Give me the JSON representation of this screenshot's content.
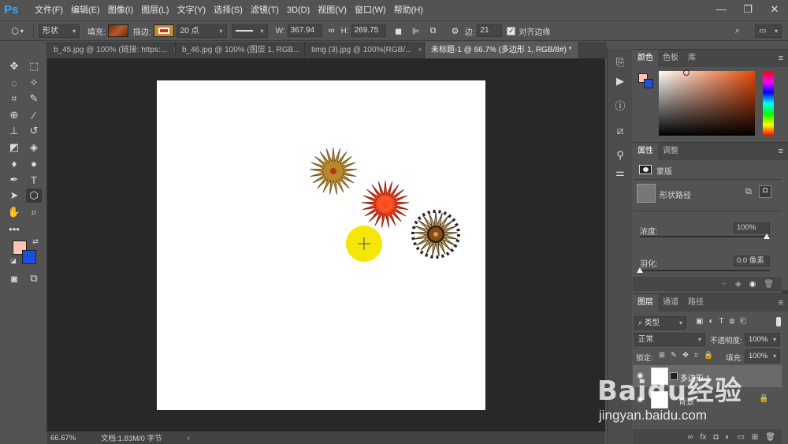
{
  "app": {
    "logo": "Ps"
  },
  "menu": [
    "文件(F)",
    "编辑(E)",
    "图像(I)",
    "图层(L)",
    "文字(Y)",
    "选择(S)",
    "滤镜(T)",
    "3D(D)",
    "视图(V)",
    "窗口(W)",
    "帮助(H)"
  ],
  "options": {
    "mode": "形状",
    "fill_label": "填充:",
    "stroke_label": "描边:",
    "stroke_width": "20 点",
    "w_label": "W:",
    "w_value": "367.94",
    "h_label": "H:",
    "h_value": "269.75",
    "sides_label": "边:",
    "sides_value": "21",
    "align_label": "对齐边缘",
    "fill_color": "#8a3d1a",
    "stroke_color": "#d49a2e"
  },
  "tabs": [
    {
      "label": "b_45.jpg @ 100% (链接: https:...",
      "close": "×"
    },
    {
      "label": "b_46.jpg @ 100% (图层 1, RGB...",
      "close": "×"
    },
    {
      "label": "timg (3).jpg @ 100%(RGB/...",
      "close": "×"
    },
    {
      "label": "未标题-1 @ 66.7% (多边形 1, RGB/8#) *",
      "close": "×"
    }
  ],
  "status": {
    "zoom": "66.67%",
    "doc": "文档:1.83M/0 字节",
    "arrow": "›"
  },
  "colors": {
    "foreground": "#ffc4b0",
    "background": "#1a4fe0"
  },
  "color_panel": {
    "tabs": [
      "颜色",
      "色板",
      "库"
    ]
  },
  "properties_panel": {
    "tabs": [
      "属性",
      "调整"
    ],
    "mask_label": "蒙版",
    "path_label": "形状路径",
    "density_label": "浓度:",
    "density_value": "100%",
    "feather_label": "羽化:",
    "feather_value": "0.0 像素"
  },
  "layers_panel": {
    "tabs": [
      "图层",
      "通道",
      "路径"
    ],
    "filter_label": "类型",
    "blend_mode": "正常",
    "opacity_label": "不透明度:",
    "opacity_value": "100%",
    "lock_label": "锁定:",
    "fill_label": "填充:",
    "fill_value": "100%",
    "layers": [
      {
        "name": "多边形 1"
      },
      {
        "name": "背景"
      }
    ]
  },
  "watermark": {
    "brand": "Baidu经验",
    "url": "jingyan.baidu.com"
  }
}
